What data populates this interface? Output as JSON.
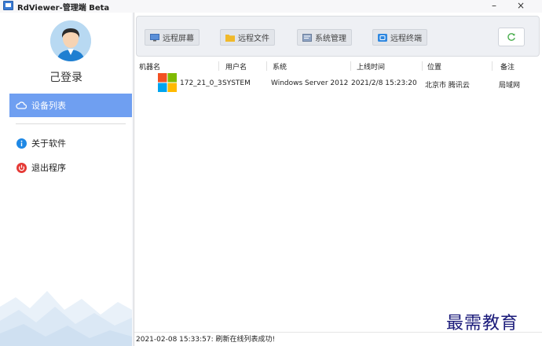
{
  "window": {
    "title": "RdViewer-管理端 Beta",
    "minimize_label": "–",
    "close_label": "×"
  },
  "sidebar": {
    "login_status": "己登录",
    "items": [
      {
        "label": "设备列表",
        "icon": "cloud-icon",
        "active": true
      },
      {
        "label": "关于软件",
        "icon": "info-icon",
        "active": false
      },
      {
        "label": "退出程序",
        "icon": "power-icon",
        "active": false
      }
    ]
  },
  "toolbar": {
    "buttons": [
      {
        "label": "远程屏幕",
        "icon": "monitor-icon"
      },
      {
        "label": "远程文件",
        "icon": "folder-icon"
      },
      {
        "label": "系统管理",
        "icon": "system-icon"
      },
      {
        "label": "远程终端",
        "icon": "terminal-icon"
      }
    ],
    "refresh_icon": "refresh-icon"
  },
  "table": {
    "columns": [
      "机器名",
      "用户名",
      "系统",
      "上线时间",
      "位置",
      "备注"
    ],
    "rows": [
      {
        "machine": "172_21_0_3",
        "user": "SYSTEM",
        "os": "Windows Server 2012 ...",
        "online_time": "2021/2/8 15:23:20",
        "location": "北京市 腾讯云",
        "note": "局域网"
      }
    ]
  },
  "status": {
    "message": "2021-02-08 15:33:57: 刷新在线列表成功!"
  },
  "watermark": {
    "text": "最需教育"
  },
  "colors": {
    "accent": "#6f9ff1",
    "info": "#1e88e5",
    "danger": "#e53935"
  }
}
